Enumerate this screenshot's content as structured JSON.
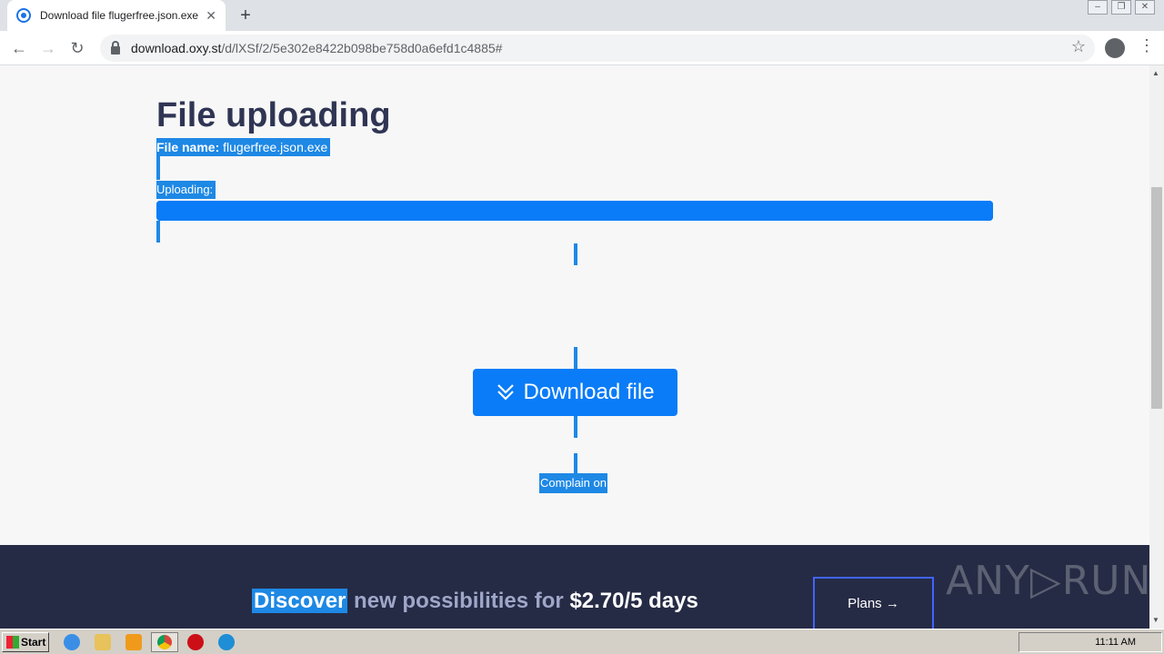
{
  "browser": {
    "tab_title": "Download file flugerfree.json.exe on",
    "tab_close": "✕",
    "new_tab": "+",
    "url_host": "download.oxy.st",
    "url_path": "/d/lXSf/2/5e302e8422b098be758d0a6efd1c4885#"
  },
  "page": {
    "title": "File uploading",
    "file_name_label": "File name:",
    "file_name_value": "flugerfree.json.exe",
    "uploading_label": "Uploading:",
    "upload_progress_percent": 100,
    "download_button": "Download file",
    "complain_label": "Complain on"
  },
  "footer": {
    "promo_highlight": "Discover",
    "promo_middle": " new possibilities for ",
    "promo_price": "$2.70/5 days",
    "plans_button": "Plans →",
    "watermark": "ANY▷RUN"
  },
  "taskbar": {
    "start_label": "Start",
    "clock": "11:11 AM"
  },
  "colors": {
    "accent": "#0a7cf7",
    "title": "#2f3553",
    "footer_bg": "#262b45"
  }
}
